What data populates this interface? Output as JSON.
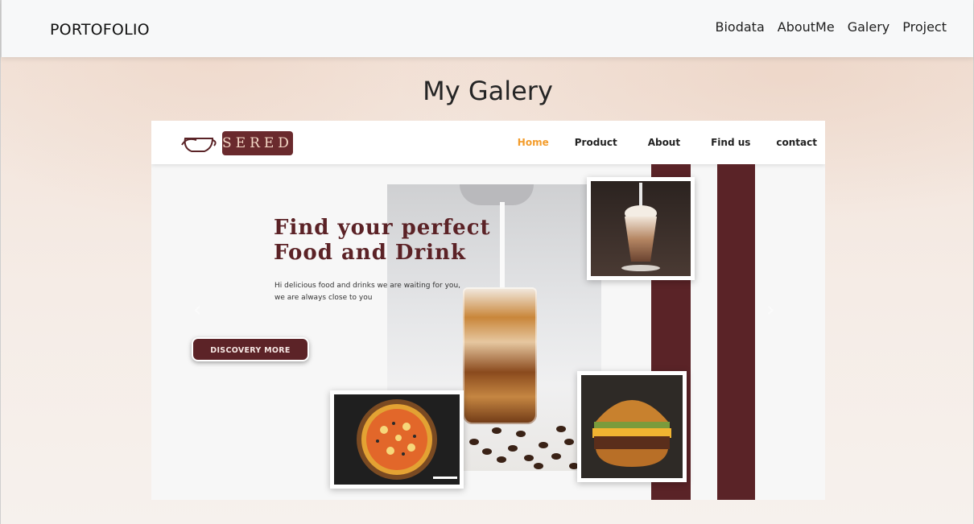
{
  "navbar": {
    "brand": "PORTOFOLIO",
    "links": [
      "Biodata",
      "AboutMe",
      "Galery",
      "Project"
    ]
  },
  "gallery": {
    "title": "My Galery",
    "slide": {
      "logo_text": "SERED",
      "menu": [
        "Home",
        "Product",
        "About",
        "Find us",
        "contact"
      ],
      "menu_active": "Home",
      "hero_title_lines": [
        "Find your perfect",
        "Food and Drink"
      ],
      "hero_sub_lines": [
        "Hi delicious food and drinks we are waiting for you,",
        "we are always close to you"
      ],
      "cta_label": "DISCOVERY MORE"
    },
    "controls": {
      "prev_icon": "chevron-left-icon",
      "next_icon": "chevron-right-icon"
    }
  },
  "colors": {
    "brand_maroon": "#5a2327",
    "active_orange": "#f39c2b",
    "navbar_bg": "#f7f8f9",
    "page_bg": "#f3e3d9"
  }
}
